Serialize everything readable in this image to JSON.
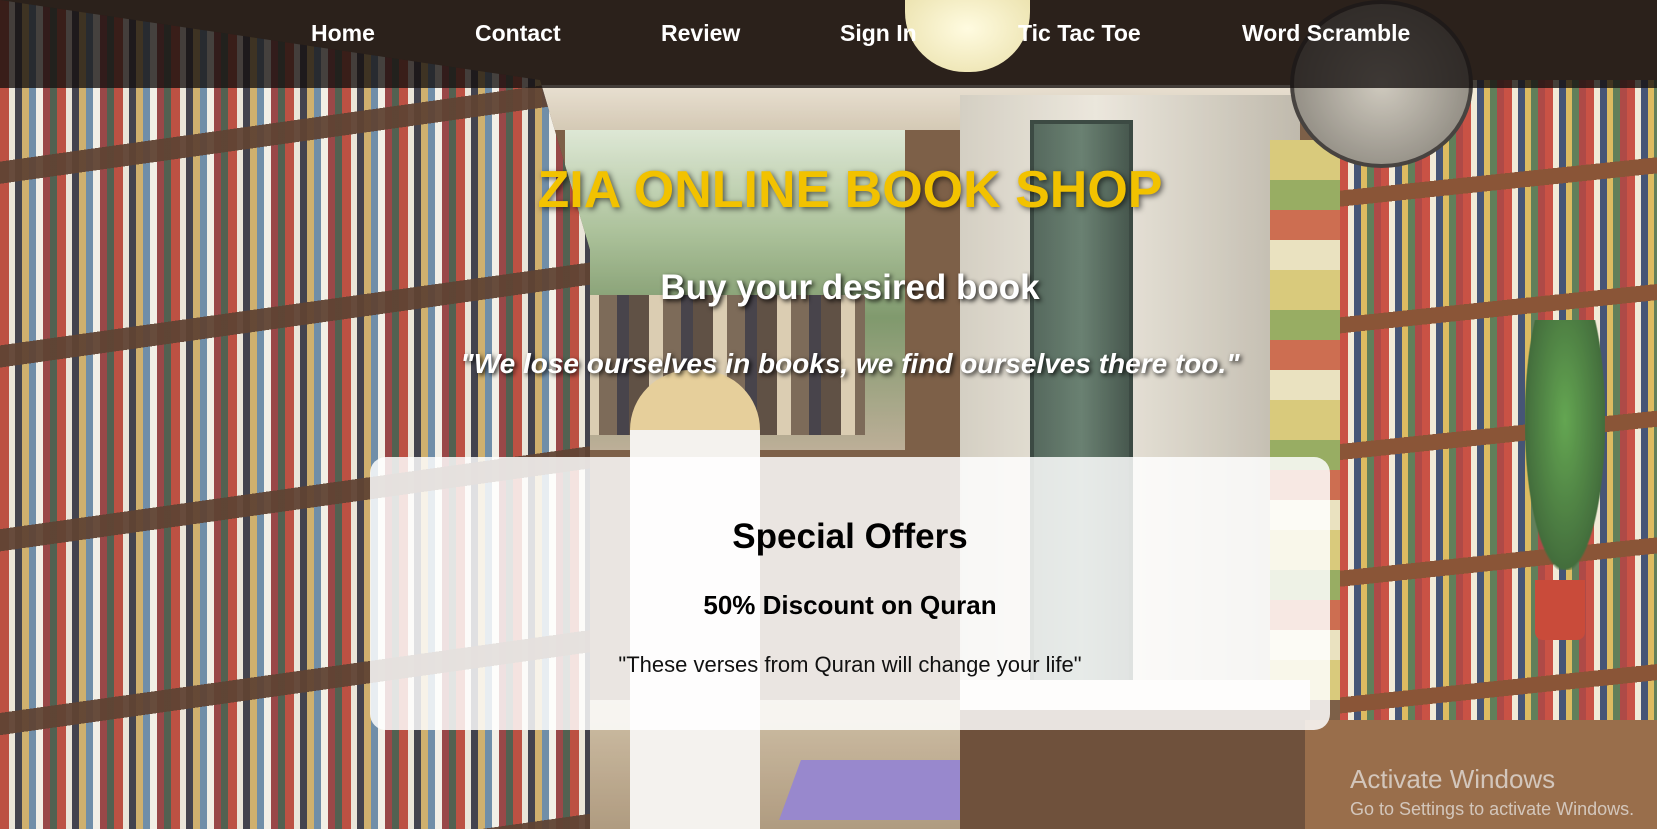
{
  "nav": {
    "items": [
      {
        "label": "Home"
      },
      {
        "label": "Contact"
      },
      {
        "label": "Review"
      },
      {
        "label": "Sign In"
      },
      {
        "label": "Tic Tac Toe"
      },
      {
        "label": "Word Scramble"
      }
    ]
  },
  "hero": {
    "title": "ZIA ONLINE BOOK SHOP",
    "subtitle": "Buy your desired book",
    "quote": "\"We lose ourselves in books, we find ourselves there too.\""
  },
  "offers": {
    "heading": "Special Offers",
    "item_title": "50% Discount on Quran",
    "item_text": "\"These verses from Quran will change your life\""
  },
  "watermark": {
    "title": "Activate Windows",
    "subtitle": "Go to Settings to activate Windows."
  },
  "colors": {
    "title": "#f2c200",
    "nav_text": "#ffffff",
    "nav_bar": "#14100e"
  }
}
